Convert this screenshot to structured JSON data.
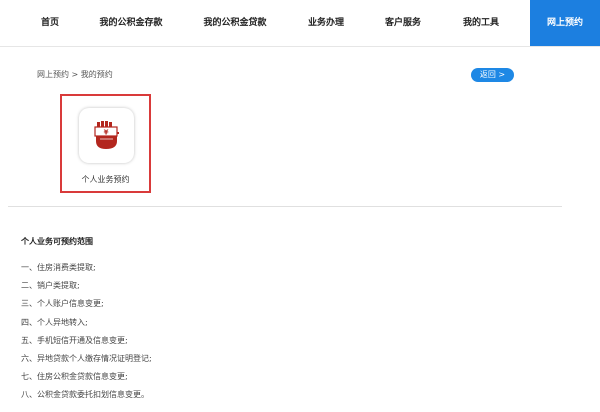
{
  "nav": {
    "items": [
      {
        "label": "首页"
      },
      {
        "label": "我的公积金存款"
      },
      {
        "label": "我的公积金贷款"
      },
      {
        "label": "业务办理"
      },
      {
        "label": "客户服务"
      },
      {
        "label": "我的工具"
      },
      {
        "label": "网上预约"
      }
    ],
    "active_index": 6,
    "active_color": "#1c7fe0"
  },
  "breadcrumb": {
    "parent": "网上预约",
    "separator": ">",
    "current": "我的预约"
  },
  "back_button": {
    "label": "返回 >",
    "color": "#1e88e5"
  },
  "service_card": {
    "label": "个人业务预约",
    "icon": "yuan-hand-icon",
    "highlight_color": "#d93a3a",
    "icon_color": "#b3261e"
  },
  "scope": {
    "title": "个人业务可预约范围",
    "items": [
      "一、住房消费类提取;",
      "二、销户类提取;",
      "三、个人账户信息变更;",
      "四、个人异地转入;",
      "五、手机短信开通及信息变更;",
      "六、异地贷款个人缴存情况证明登记;",
      "七、住房公积金贷款信息变更;",
      "八、公积金贷款委托扣划信息变更。"
    ]
  }
}
